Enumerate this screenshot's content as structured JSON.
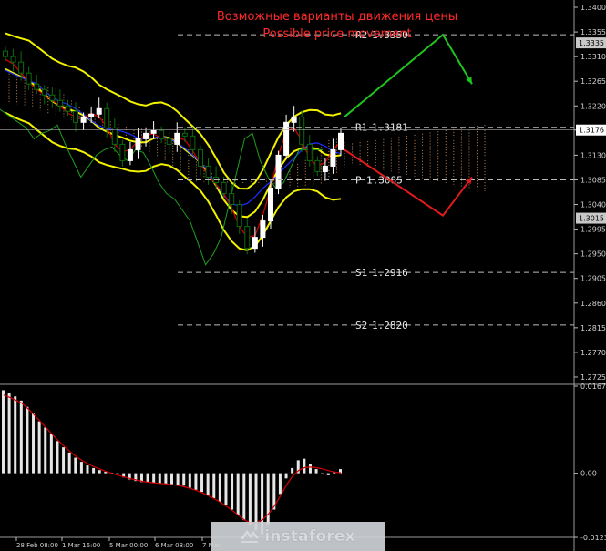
{
  "chart_data": [
    {
      "type": "candlestick",
      "title": "Возможные варианты движения цены",
      "subtitle": "Possible price movement",
      "ylim": [
        1.2715,
        1.341
      ],
      "y_ticks": [
        "1.3400",
        "1.3355",
        "1.3310",
        "1.3265",
        "1.3220",
        "1.3176",
        "1.3130",
        "1.3085",
        "1.3040",
        "1.2995",
        "1.2950",
        "1.2905",
        "1.2860",
        "1.2815",
        "1.2770",
        "1.2725"
      ],
      "highlighted_prices": [
        "1.3335",
        "1.3176",
        "1.3015"
      ],
      "x_ticks": [
        "28 Feb 08:00",
        "1 Mar 16:00",
        "5 Mar 00:00",
        "6 Mar 08:00",
        "7 Mar"
      ],
      "levels": [
        {
          "label": "R2",
          "value": "1.3350",
          "price": 1.335
        },
        {
          "label": "R1",
          "value": "1.3181",
          "price": 1.3181
        },
        {
          "label": "P",
          "value": "1.3085",
          "price": 1.3085
        },
        {
          "label": "S1",
          "value": "1.2916",
          "price": 1.2916
        },
        {
          "label": "S2",
          "value": "1.2820",
          "price": 1.282
        }
      ],
      "current_price": 1.3176,
      "close_series": [
        1.331,
        1.33,
        1.328,
        1.326,
        1.325,
        1.324,
        1.323,
        1.322,
        1.321,
        1.319,
        1.32,
        1.3205,
        1.3215,
        1.318,
        1.315,
        1.312,
        1.314,
        1.316,
        1.317,
        1.3175,
        1.316,
        1.315,
        1.317,
        1.3165,
        1.314,
        1.311,
        1.309,
        1.308,
        1.306,
        1.304,
        1.3,
        1.296,
        1.298,
        1.301,
        1.307,
        1.313,
        1.319,
        1.32,
        1.315,
        1.312,
        1.31,
        1.311,
        1.314,
        1.317
      ],
      "projections": [
        {
          "direction": "up",
          "color": "#1fc41f",
          "path": [
            1.32,
            1.335,
            1.326
          ]
        },
        {
          "direction": "down",
          "color": "#e11b1b",
          "path": [
            1.314,
            1.302,
            1.309
          ]
        }
      ]
    },
    {
      "type": "bar",
      "name": "oscillator",
      "ylim": [
        -0.01235,
        0.01678
      ],
      "y_ticks": [
        "0.01678",
        "0.00",
        "-0.01235"
      ],
      "values": [
        0.016,
        0.0155,
        0.0148,
        0.014,
        0.0128,
        0.0115,
        0.01,
        0.0088,
        0.0075,
        0.0062,
        0.005,
        0.004,
        0.003,
        0.0022,
        0.0015,
        0.001,
        0.0006,
        0.0003,
        0.0001,
        -0.0002,
        -0.0008,
        -0.0012,
        -0.0015,
        -0.0017,
        -0.0018,
        -0.0019,
        -0.002,
        -0.002,
        -0.0021,
        -0.0022,
        -0.0024,
        -0.0028,
        -0.0032,
        -0.0036,
        -0.0042,
        -0.0048,
        -0.0055,
        -0.0062,
        -0.007,
        -0.008,
        -0.009,
        -0.01,
        -0.011,
        -0.0118,
        -0.01,
        -0.007,
        -0.004,
        -0.001,
        0.001,
        0.0025,
        0.0028,
        0.0018,
        0.0008,
        -0.0002,
        -0.0004,
        0.0002,
        0.0008
      ]
    }
  ],
  "watermark": {
    "brand": "instaforex"
  },
  "colors": {
    "bull": "#ffffff",
    "bear": "#0b6b0b",
    "yellow": "#f2f200",
    "red": "#d40000",
    "blue": "#1c30ff",
    "kumo": "#e8a067",
    "up_arrow": "#1fc41f",
    "down_arrow": "#e11b1b",
    "title": "#ff2a2a"
  }
}
